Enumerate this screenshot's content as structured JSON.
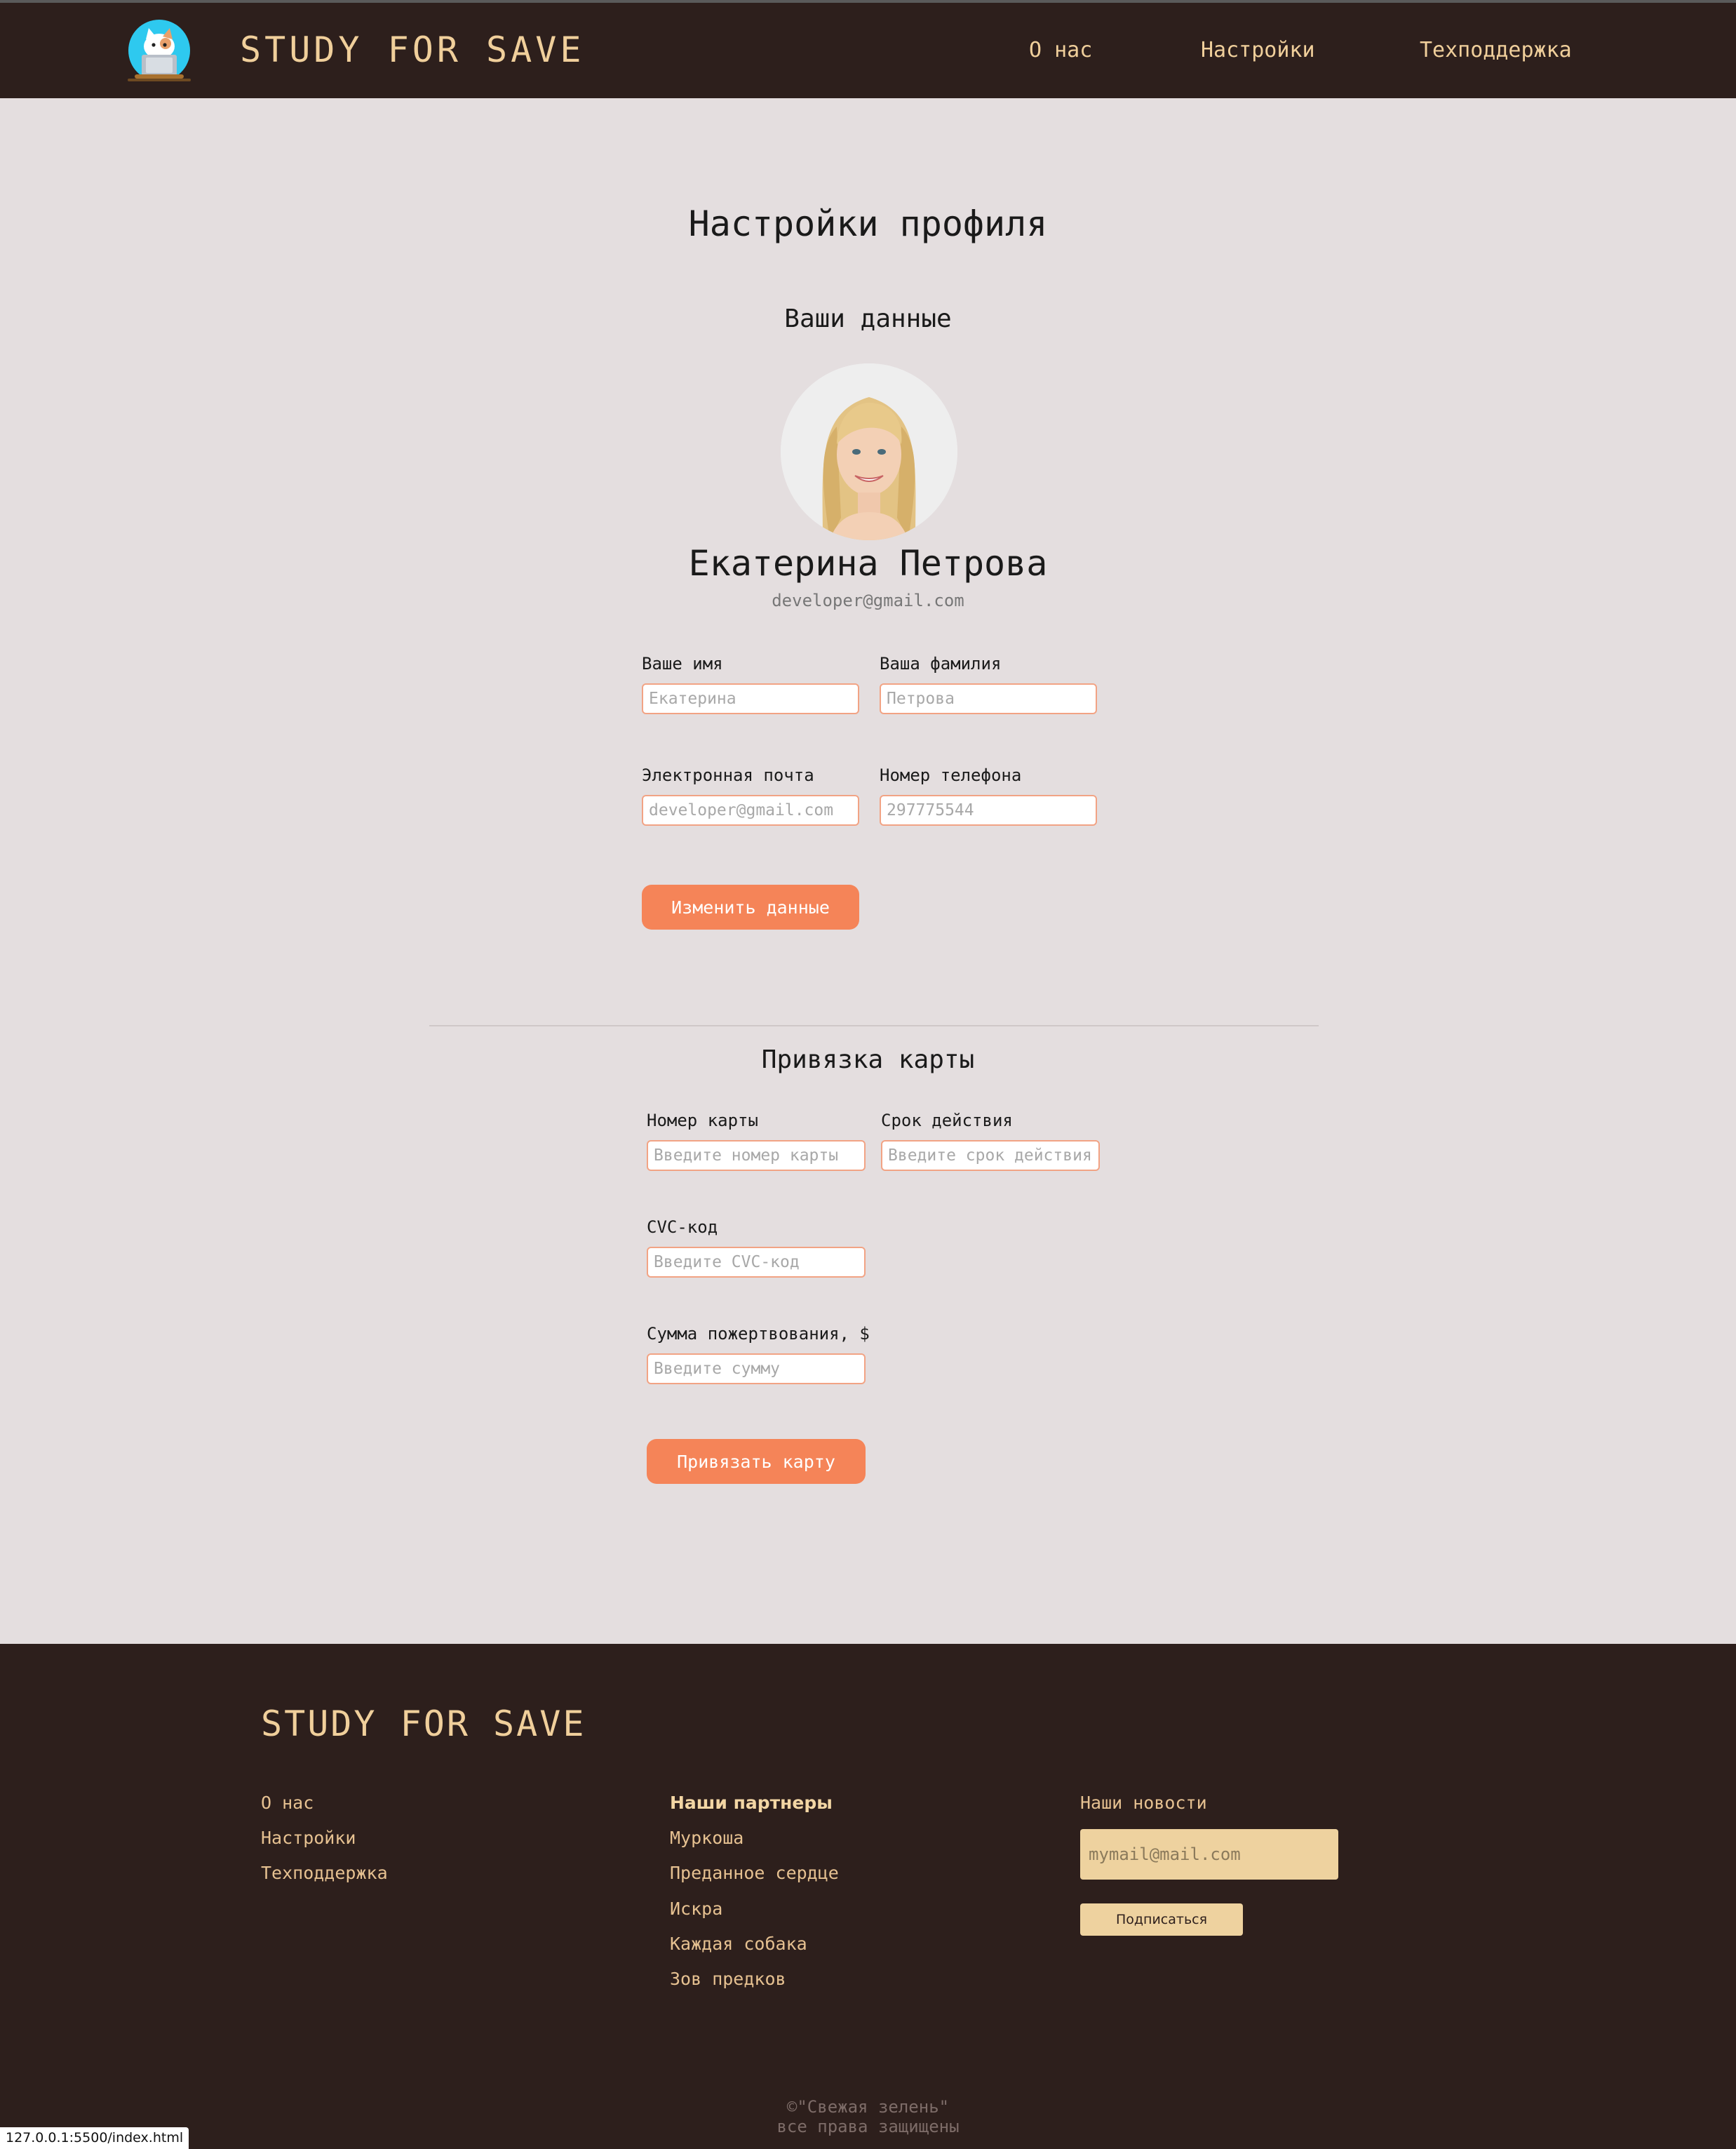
{
  "header": {
    "brand": "STUDY FOR SAVE",
    "nav": [
      "О нас",
      "Настройки",
      "Техподдержка"
    ]
  },
  "profile": {
    "page_title": "Настройки профиля",
    "section_title": "Ваши данные",
    "full_name": "Екатерина Петрова",
    "email": "developer@gmail.com",
    "fields": {
      "first_name": {
        "label": "Ваше имя",
        "placeholder": "Екатерина"
      },
      "last_name": {
        "label": "Ваша фамилия",
        "placeholder": "Петрова"
      },
      "email": {
        "label": "Электронная почта",
        "placeholder": "developer@gmail.com"
      },
      "phone": {
        "label": "Номер телефона",
        "placeholder": "297775544"
      }
    },
    "submit_label": "Изменить данные"
  },
  "card": {
    "section_title": "Привязка карты",
    "fields": {
      "number": {
        "label": "Номер карты",
        "placeholder": "Введите номер карты"
      },
      "expiry": {
        "label": "Срок действия",
        "placeholder": "Введите срок действия"
      },
      "cvc": {
        "label": "CVC-код",
        "placeholder": "Введите CVC-код"
      },
      "amount": {
        "label": "Сумма пожертвования, $",
        "placeholder": "Введите сумму"
      }
    },
    "submit_label": "Привязать карту"
  },
  "footer": {
    "brand": "STUDY FOR SAVE",
    "links": [
      "О нас",
      "Настройки",
      "Техподдержка"
    ],
    "partners_title": "Наши партнеры",
    "partners": [
      "Муркоша",
      "Преданное сердце",
      "Искра",
      "Каждая собака",
      "Зов предков"
    ],
    "news_title": "Наши новости",
    "news_placeholder": "mymail@mail.com",
    "subscribe_label": "Подписаться",
    "copyright_line1": "©\"Свежая зелень\"",
    "copyright_line2": "все права защищены"
  },
  "status_bar": {
    "url": "127.0.0.1:5500/index.html"
  },
  "colors": {
    "header_bg": "#2d1f1c",
    "page_bg": "#e4dedf",
    "accent": "#f58458",
    "brand_text": "#f0cf9b",
    "input_border": "#f2a384",
    "footer_input": "#eed29f"
  },
  "icons": {
    "logo": "cat-laptop-logo-icon"
  }
}
